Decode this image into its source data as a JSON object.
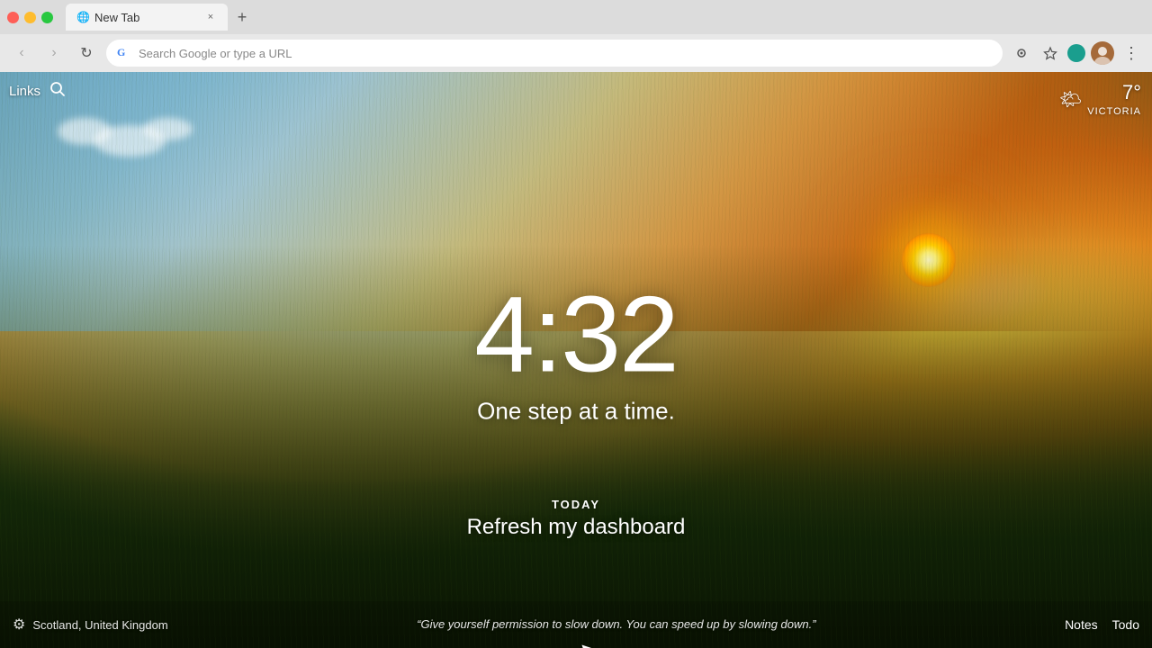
{
  "browser": {
    "traffic_lights": [
      "close",
      "minimize",
      "maximize"
    ],
    "tab": {
      "title": "New Tab",
      "close_label": "×"
    },
    "new_tab_icon": "+",
    "nav": {
      "back_icon": "‹",
      "forward_icon": "›",
      "reload_icon": "↻"
    },
    "address_bar": {
      "placeholder": "Search Google or type a URL",
      "google_letter": "G"
    },
    "toolbar": {
      "screenshot_icon": "⊙",
      "star_icon": "☆",
      "menu_icon": "⋮"
    }
  },
  "ntp": {
    "top_left": {
      "links_label": "Links",
      "search_icon": "🔍"
    },
    "weather": {
      "icon": "🌤",
      "temperature": "7°",
      "city": "VICTORIA"
    },
    "clock": "4:32",
    "tagline": "One step at a time.",
    "today": {
      "label": "TODAY",
      "task": "Refresh my dashboard"
    },
    "bottom": {
      "settings_icon": "⚙",
      "location": "Scotland, United Kingdom",
      "quote": "“Give yourself permission to slow down. You can speed up by slowing down.”",
      "notes_label": "Notes",
      "todo_label": "Todo"
    }
  }
}
